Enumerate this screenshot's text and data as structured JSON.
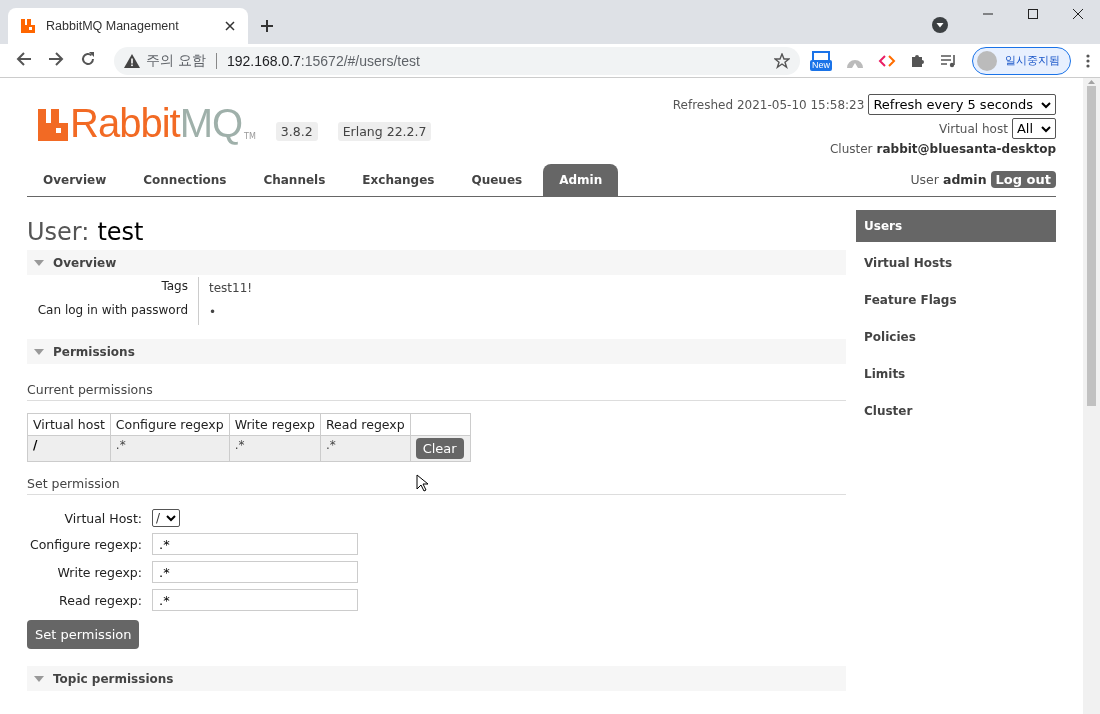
{
  "browser": {
    "tab": {
      "title": "RabbitMQ Management"
    },
    "address": {
      "warning": "주의 요함",
      "host": "192.168.0.7",
      "path": ":15672/#/users/test"
    },
    "extension_badge": "New",
    "profile": {
      "label": "일시중지됨"
    }
  },
  "header": {
    "logo": {
      "brand": "Rabbit",
      "suffix": "MQ",
      "mark": "TM"
    },
    "versions": [
      "3.8.2",
      "Erlang 22.2.7"
    ],
    "refreshed": "Refreshed 2021-05-10 15:58:23",
    "refresh_select": "Refresh every 5 seconds",
    "vhost_label": "Virtual host",
    "vhost_select": "All",
    "cluster_label": "Cluster",
    "cluster": "rabbit@bluesanta-desktop",
    "user_label": "User",
    "user": "admin",
    "logout": "Log out"
  },
  "nav": [
    {
      "label": "Overview",
      "selected": false
    },
    {
      "label": "Connections",
      "selected": false
    },
    {
      "label": "Channels",
      "selected": false
    },
    {
      "label": "Exchanges",
      "selected": false
    },
    {
      "label": "Queues",
      "selected": false
    },
    {
      "label": "Admin",
      "selected": true
    }
  ],
  "page": {
    "title_label": "User:",
    "title_value": "test"
  },
  "overview": {
    "title": "Overview",
    "expanded": true,
    "rows": [
      {
        "key": "Tags",
        "value": "test11!"
      },
      {
        "key": "Can log in with password",
        "value": "•"
      }
    ]
  },
  "permissions": {
    "title": "Permissions",
    "expanded": true,
    "current_title": "Current permissions",
    "columns": [
      "Virtual host",
      "Configure regexp",
      "Write regexp",
      "Read regexp"
    ],
    "rows": [
      {
        "cells": [
          "/",
          ".*",
          ".*",
          ".*"
        ],
        "action": "Clear"
      }
    ],
    "set_title": "Set permission",
    "fields": [
      {
        "kind": "select",
        "label": "Virtual Host:",
        "value": "/"
      },
      {
        "kind": "text",
        "label": "Configure regexp:",
        "value": ".*"
      },
      {
        "kind": "text",
        "label": "Write regexp:",
        "value": ".*"
      },
      {
        "kind": "text",
        "label": "Read regexp:",
        "value": ".*"
      }
    ],
    "submit": "Set permission"
  },
  "topic_permissions": {
    "title": "Topic permissions",
    "expanded": true
  },
  "sidebar": [
    {
      "label": "Users",
      "selected": true
    },
    {
      "label": "Virtual Hosts",
      "selected": false
    },
    {
      "label": "Feature Flags",
      "selected": false
    },
    {
      "label": "Policies",
      "selected": false
    },
    {
      "label": "Limits",
      "selected": false
    },
    {
      "label": "Cluster",
      "selected": false
    }
  ]
}
